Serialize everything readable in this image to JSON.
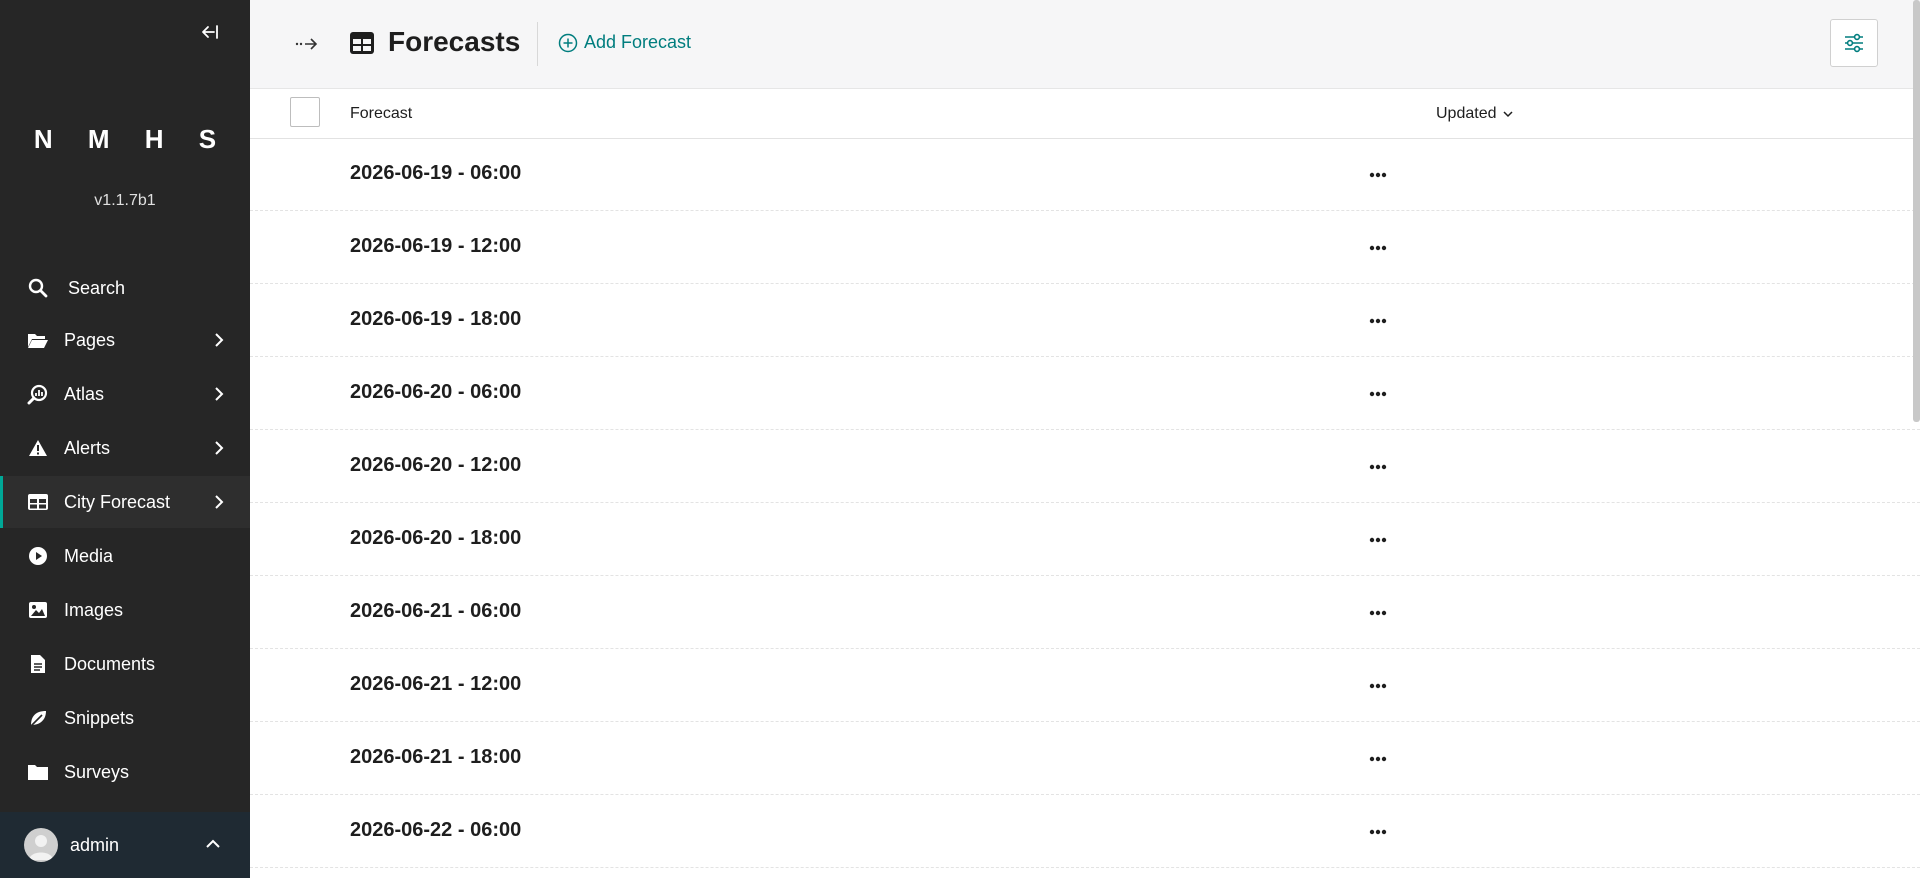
{
  "sidebar": {
    "brand": "N M H S",
    "version": "v1.1.7b1",
    "items": [
      {
        "label": "Search",
        "icon": "search-icon"
      },
      {
        "label": "Pages",
        "icon": "folder-open-icon"
      },
      {
        "label": "Atlas",
        "icon": "atlas-search-icon"
      },
      {
        "label": "Alerts",
        "icon": "warning-icon"
      },
      {
        "label": "City Forecast",
        "icon": "table-icon"
      },
      {
        "label": "Media",
        "icon": "play-icon"
      },
      {
        "label": "Images",
        "icon": "image-icon"
      },
      {
        "label": "Documents",
        "icon": "document-icon"
      },
      {
        "label": "Snippets",
        "icon": "snippet-icon"
      },
      {
        "label": "Surveys",
        "icon": "folder-icon"
      }
    ],
    "active_item": "City Forecast",
    "account": {
      "name": "admin"
    }
  },
  "header": {
    "title": "Forecasts",
    "add_label": "Add Forecast"
  },
  "table": {
    "columns": {
      "forecast": "Forecast",
      "updated": "Updated"
    },
    "rows": [
      "2026-06-19 - 06:00",
      "2026-06-19 - 12:00",
      "2026-06-19 - 18:00",
      "2026-06-20 - 06:00",
      "2026-06-20 - 12:00",
      "2026-06-20 - 18:00",
      "2026-06-21 - 06:00",
      "2026-06-21 - 12:00",
      "2026-06-21 - 18:00",
      "2026-06-22 - 06:00"
    ]
  },
  "colors": {
    "accent": "#007d7e",
    "sidebar_bg": "#262626",
    "active_border": "#00a897"
  }
}
